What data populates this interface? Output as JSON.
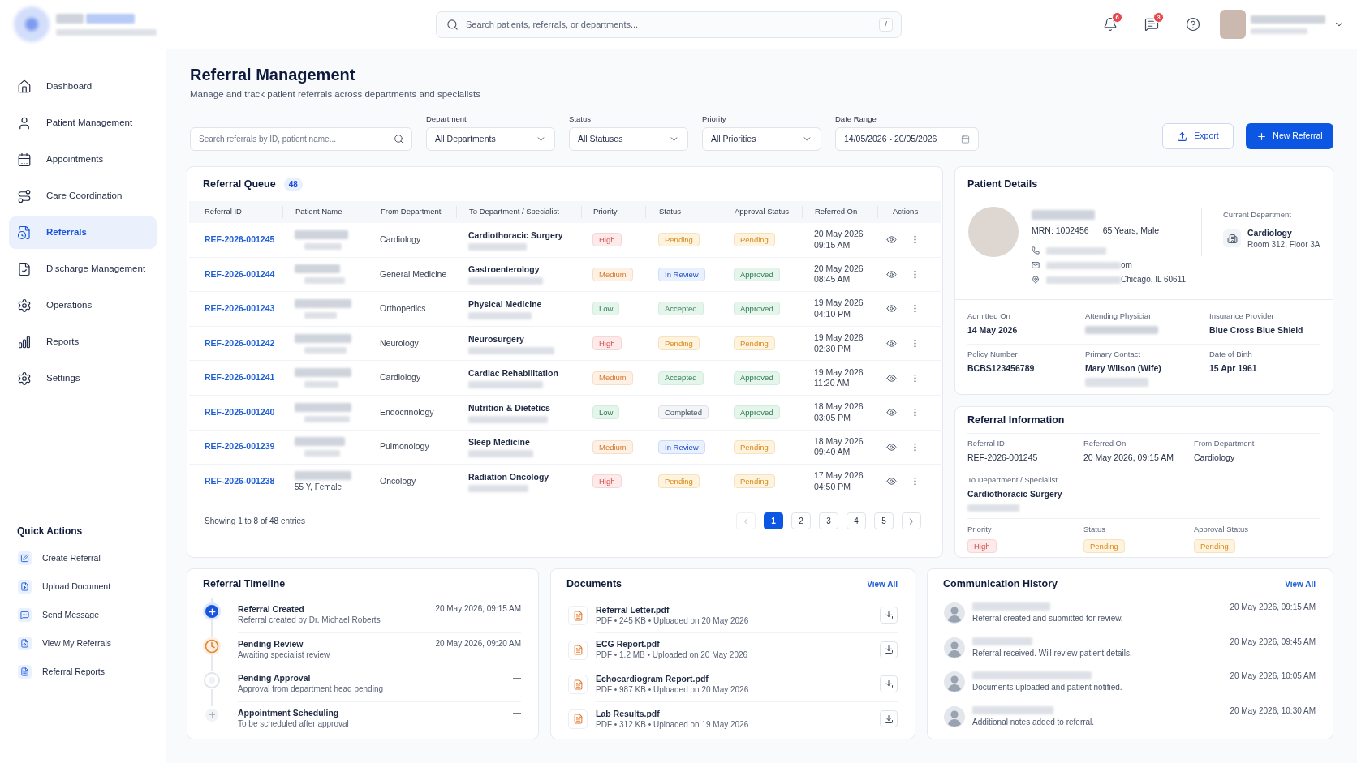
{
  "header": {
    "search": {
      "placeholder": "Search patients, referrals, or departments...",
      "shortcut": "/"
    },
    "notifications": {
      "count": "6"
    },
    "messages": {
      "count": "3"
    }
  },
  "sidebar": {
    "items": [
      {
        "label": "Dashboard",
        "selected": false
      },
      {
        "label": "Patient Management",
        "selected": false
      },
      {
        "label": "Appointments",
        "selected": false
      },
      {
        "label": "Care Coordination",
        "selected": false
      },
      {
        "label": "Referrals",
        "selected": true
      },
      {
        "label": "Discharge Management",
        "selected": false
      },
      {
        "label": "Operations",
        "selected": false
      },
      {
        "label": "Reports",
        "selected": false
      },
      {
        "label": "Settings",
        "selected": false
      }
    ],
    "quick_actions": {
      "title": "Quick Actions",
      "items": [
        "Create Referral",
        "Upload Document",
        "Send Message",
        "View My Referrals",
        "Referral Reports"
      ]
    }
  },
  "page": {
    "title": "Referral Management",
    "subtitle": "Manage and track patient referrals across departments and specialists"
  },
  "filters": {
    "search": {
      "placeholder": "Search referrals by ID, patient name..."
    },
    "dropdowns": [
      {
        "label": "Department",
        "value": "All Departments",
        "kind": "select"
      },
      {
        "label": "Status",
        "value": "All Statuses",
        "kind": "select"
      },
      {
        "label": "Priority",
        "value": "All Priorities",
        "kind": "select"
      },
      {
        "label": "Date Range",
        "value": "14/05/2026 - 20/05/2026",
        "kind": "date"
      }
    ],
    "buttons": [
      {
        "label": "Export",
        "kind": "secondary"
      },
      {
        "label": "New Referral",
        "kind": "primary"
      }
    ]
  },
  "referral_queue": {
    "title": "Referral Queue",
    "count": "48",
    "columns": [
      "Referral ID",
      "Patient Name",
      "From Department",
      "To Department / Specialist",
      "Priority",
      "Status",
      "Approval Status",
      "Referred On",
      "Actions"
    ],
    "rows": [
      {
        "id": "REF-2026-001245",
        "from": "Cardiology",
        "to": "Cardiothoracic Surgery",
        "priority": {
          "label": "High",
          "kind": "danger"
        },
        "status": {
          "label": "Pending",
          "kind": "caution"
        },
        "approval": {
          "label": "Pending",
          "kind": "caution"
        },
        "date": "20 May 2026",
        "time": "09:15 AM"
      },
      {
        "id": "REF-2026-001244",
        "from": "General Medicine",
        "to": "Gastroenterology",
        "priority": {
          "label": "Medium",
          "kind": "warning"
        },
        "status": {
          "label": "In Review",
          "kind": "info"
        },
        "approval": {
          "label": "Approved",
          "kind": "success"
        },
        "date": "20 May 2026",
        "time": "08:45 AM"
      },
      {
        "id": "REF-2026-001243",
        "from": "Orthopedics",
        "to": "Physical Medicine",
        "priority": {
          "label": "Low",
          "kind": "success"
        },
        "status": {
          "label": "Accepted",
          "kind": "success"
        },
        "approval": {
          "label": "Approved",
          "kind": "success"
        },
        "date": "19 May 2026",
        "time": "04:10 PM"
      },
      {
        "id": "REF-2026-001242",
        "from": "Neurology",
        "to": "Neurosurgery",
        "priority": {
          "label": "High",
          "kind": "danger"
        },
        "status": {
          "label": "Pending",
          "kind": "caution"
        },
        "approval": {
          "label": "Pending",
          "kind": "caution"
        },
        "date": "19 May 2026",
        "time": "02:30 PM"
      },
      {
        "id": "REF-2026-001241",
        "from": "Cardiology",
        "to": "Cardiac Rehabilitation",
        "priority": {
          "label": "Medium",
          "kind": "warning"
        },
        "status": {
          "label": "Accepted",
          "kind": "success"
        },
        "approval": {
          "label": "Approved",
          "kind": "success"
        },
        "date": "19 May 2026",
        "time": "11:20 AM"
      },
      {
        "id": "REF-2026-001240",
        "from": "Endocrinology",
        "to": "Nutrition & Dietetics",
        "priority": {
          "label": "Low",
          "kind": "success"
        },
        "status": {
          "label": "Completed",
          "kind": "neutral"
        },
        "approval": {
          "label": "Approved",
          "kind": "success"
        },
        "date": "18 May 2026",
        "time": "03:05 PM"
      },
      {
        "id": "REF-2026-001239",
        "from": "Pulmonology",
        "to": "Sleep Medicine",
        "priority": {
          "label": "Medium",
          "kind": "warning"
        },
        "status": {
          "label": "In Review",
          "kind": "info"
        },
        "approval": {
          "label": "Pending",
          "kind": "caution"
        },
        "date": "18 May 2026",
        "time": "09:40 AM"
      },
      {
        "id": "REF-2026-001238",
        "patient_info": "55 Y, Female",
        "from": "Oncology",
        "to": "Radiation Oncology",
        "priority": {
          "label": "High",
          "kind": "danger"
        },
        "status": {
          "label": "Pending",
          "kind": "caution"
        },
        "approval": {
          "label": "Pending",
          "kind": "caution"
        },
        "date": "17 May 2026",
        "time": "04:50 PM"
      }
    ],
    "summary": "Showing 1 to 8 of 48 entries",
    "pagination": {
      "previous": {
        "disabled": true
      },
      "pages": [
        {
          "label": "1",
          "selected": true
        },
        {
          "label": "2",
          "selected": false
        },
        {
          "label": "3",
          "selected": false
        },
        {
          "label": "4",
          "selected": false
        },
        {
          "label": "5",
          "selected": false
        }
      ],
      "next": {
        "disabled": false
      }
    }
  },
  "patient_details": {
    "title": "Patient Details",
    "mrn": "MRN: 1002456",
    "age_sex": "65 Years, Male",
    "email_visible": "om",
    "address_visible": "Chicago, IL 60611",
    "current_department": {
      "label": "Current Department",
      "name": "Cardiology",
      "location": "Room 312, Floor 3A"
    },
    "fields": [
      {
        "label": "Admitted On",
        "value": "14 May 2026",
        "blurred_detail": false
      },
      {
        "label": "Attending Physician",
        "blurred_detail": false
      },
      {
        "label": "Insurance Provider",
        "value": "Blue Cross Blue Shield",
        "blurred_detail": false
      },
      {
        "label": "Policy Number",
        "value": "BCBS123456789",
        "blurred_detail": false
      },
      {
        "label": "Primary Contact",
        "value": "Mary Wilson (Wife)",
        "blurred_detail": true
      },
      {
        "label": "Date of Birth",
        "value": "15 Apr 1961",
        "blurred_detail": false
      }
    ]
  },
  "referral_information": {
    "title": "Referral Information",
    "fields": [
      {
        "label": "Referral ID",
        "value": "REF-2026-001245"
      },
      {
        "label": "Referred On",
        "value": "20 May 2026, 09:15 AM"
      },
      {
        "label": "From Department",
        "value": "Cardiology"
      }
    ],
    "to": {
      "label": "To Department / Specialist",
      "value": "Cardiothoracic Surgery"
    },
    "badges": [
      {
        "label": "Priority",
        "badge": {
          "label": "High",
          "kind": "danger"
        }
      },
      {
        "label": "Status",
        "badge": {
          "label": "Pending",
          "kind": "caution"
        }
      },
      {
        "label": "Approval Status",
        "badge": {
          "label": "Pending",
          "kind": "caution"
        }
      }
    ]
  },
  "timeline": {
    "title": "Referral Timeline",
    "steps": [
      {
        "title": "Referral Created",
        "description": "Referral created by Dr. Michael Roberts",
        "time": "20 May 2026, 09:15 AM",
        "kind": "done"
      },
      {
        "title": "Pending Review",
        "description": "Awaiting specialist review",
        "time": "20 May 2026, 09:20 AM",
        "kind": "current"
      },
      {
        "title": "Pending Approval",
        "description": "Approval from department head pending",
        "time": "—",
        "kind": "pending"
      },
      {
        "title": "Appointment Scheduling",
        "description": "To be scheduled after approval",
        "time": "—",
        "kind": "upcoming"
      }
    ]
  },
  "documents": {
    "title": "Documents",
    "link": "View All",
    "files": [
      {
        "name": "Referral Letter.pdf",
        "meta": "PDF • 245 KB • Uploaded on 20 May 2026"
      },
      {
        "name": "ECG Report.pdf",
        "meta": "PDF • 1.2 MB • Uploaded on 20 May 2026"
      },
      {
        "name": "Echocardiogram Report.pdf",
        "meta": "PDF • 987 KB • Uploaded on 20 May 2026"
      },
      {
        "name": "Lab Results.pdf",
        "meta": "PDF • 312 KB • Uploaded on 19 May 2026"
      }
    ]
  },
  "communication_history": {
    "title": "Communication History",
    "link": "View All",
    "messages": [
      {
        "text": "Referral created and submitted for review.",
        "time": "20 May 2026, 09:15 AM"
      },
      {
        "text": "Referral received. Will review patient details.",
        "time": "20 May 2026, 09:45 AM"
      },
      {
        "text": "Documents uploaded and patient notified.",
        "time": "20 May 2026, 10:05 AM"
      },
      {
        "text": "Additional notes added to referral.",
        "time": "20 May 2026, 10:30 AM"
      }
    ]
  }
}
